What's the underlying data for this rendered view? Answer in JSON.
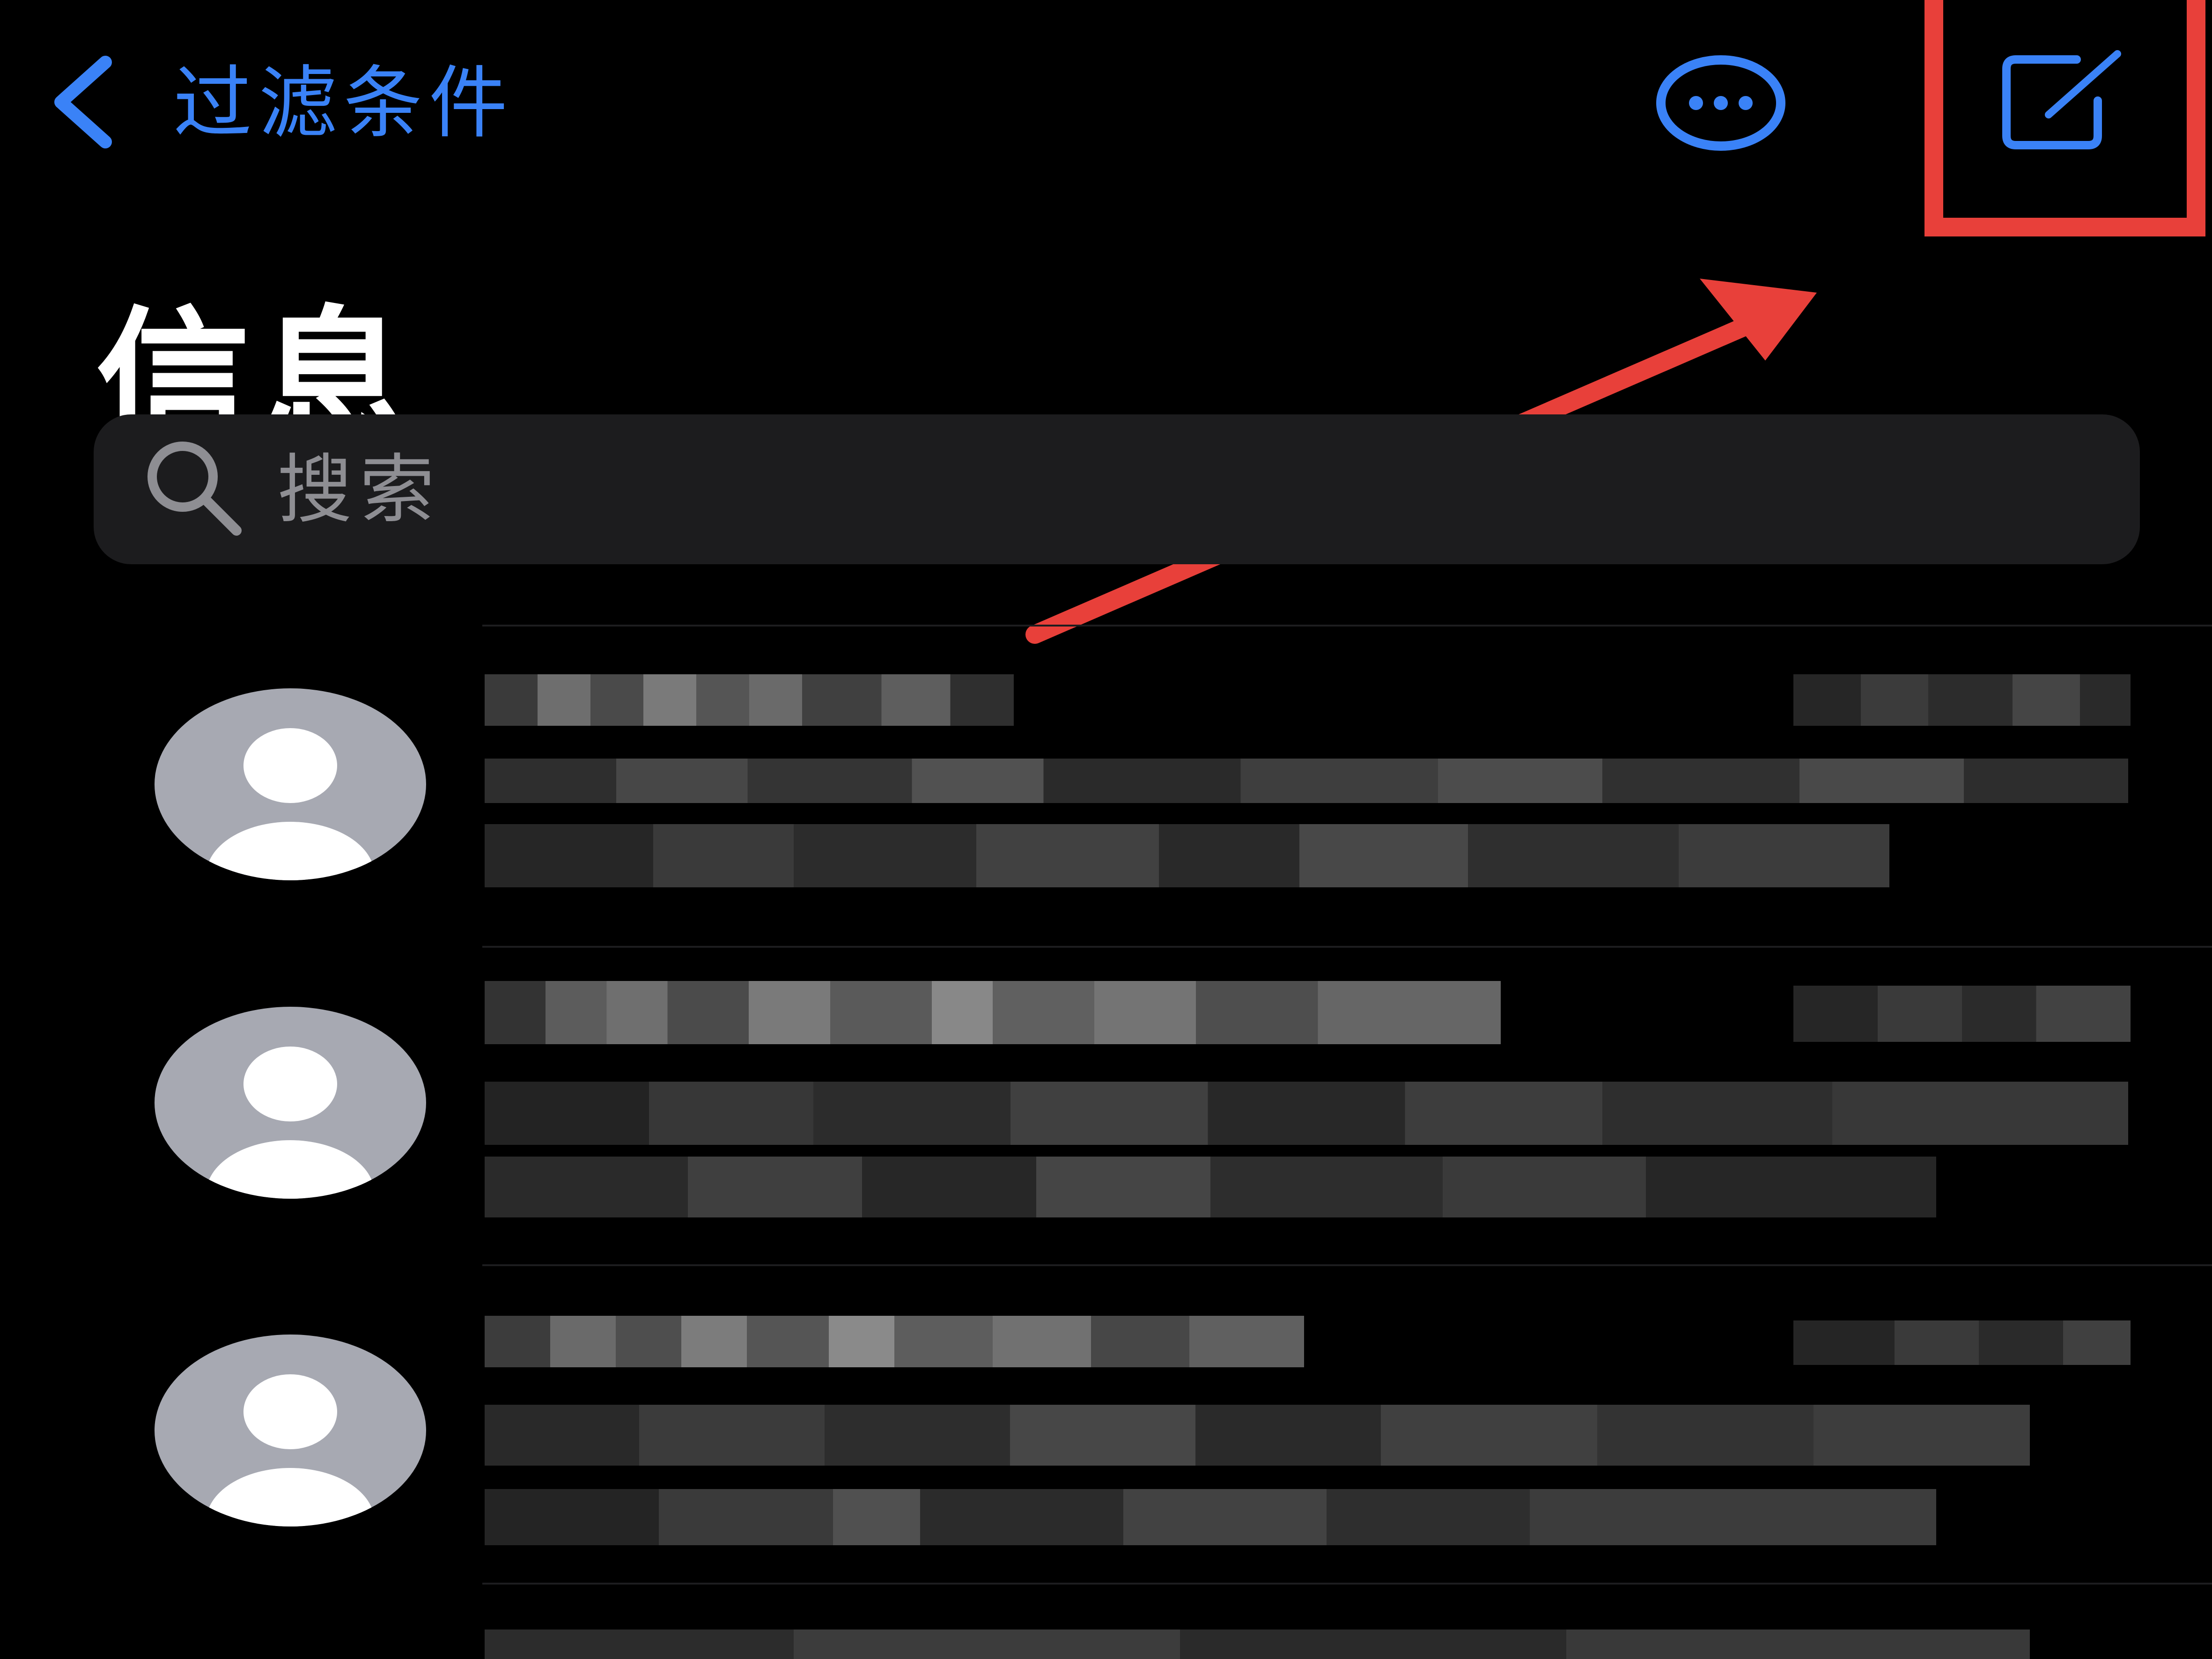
{
  "nav": {
    "back_label": "过滤条件"
  },
  "header": {
    "title": "信息"
  },
  "search": {
    "placeholder": "搜索"
  },
  "icons": {
    "back": "chevron-left-icon",
    "more": "ellipsis-circle-icon",
    "compose": "compose-icon",
    "search": "search-icon",
    "avatar": "person-placeholder-icon"
  },
  "colors": {
    "accent": "#3a82f7",
    "annotation": "#e8403a",
    "background": "#000000",
    "search_background": "#1c1c1e",
    "avatar_background": "#a7a9b2"
  },
  "conversations": [
    {
      "redacted": true
    },
    {
      "redacted": true
    },
    {
      "redacted": true
    }
  ]
}
